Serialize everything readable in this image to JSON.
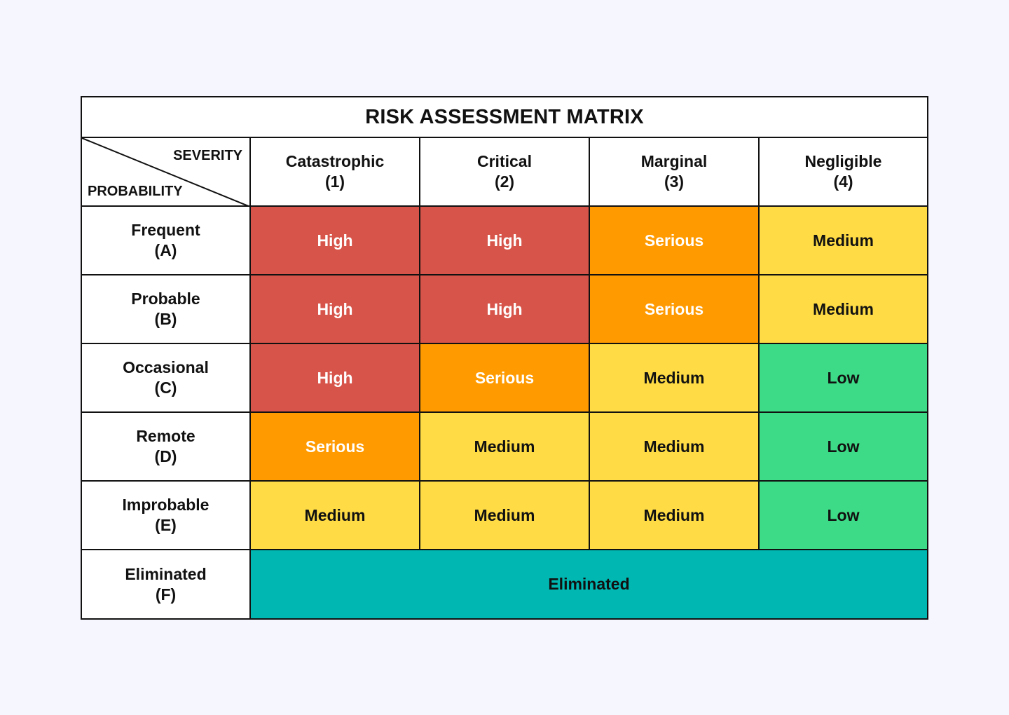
{
  "title": "RISK ASSESSMENT MATRIX",
  "corner": {
    "severity_label": "SEVERITY",
    "probability_label": "PROBABILITY"
  },
  "colors": {
    "High": {
      "bg": "#d65449",
      "fg": "#ffffff"
    },
    "Serious": {
      "bg": "#ff9a00",
      "fg": "#ffffff"
    },
    "Medium": {
      "bg": "#ffdc45",
      "fg": "#111111"
    },
    "Low": {
      "bg": "#3ddb87",
      "fg": "#111111"
    },
    "Eliminated": {
      "bg": "#00b7b1",
      "fg": "#111111"
    }
  },
  "severity": [
    {
      "name": "Catastrophic",
      "code": "(1)"
    },
    {
      "name": "Critical",
      "code": "(2)"
    },
    {
      "name": "Marginal",
      "code": "(3)"
    },
    {
      "name": "Negligible",
      "code": "(4)"
    }
  ],
  "rows": [
    {
      "name": "Frequent",
      "code": "(A)",
      "cells": [
        "High",
        "High",
        "Serious",
        "Medium"
      ]
    },
    {
      "name": "Probable",
      "code": "(B)",
      "cells": [
        "High",
        "High",
        "Serious",
        "Medium"
      ]
    },
    {
      "name": "Occasional",
      "code": "(C)",
      "cells": [
        "High",
        "Serious",
        "Medium",
        "Low"
      ]
    },
    {
      "name": "Remote",
      "code": "(D)",
      "cells": [
        "Serious",
        "Medium",
        "Medium",
        "Low"
      ]
    },
    {
      "name": "Improbable",
      "code": "(E)",
      "cells": [
        "Medium",
        "Medium",
        "Medium",
        "Low"
      ]
    }
  ],
  "eliminated_row": {
    "name": "Eliminated",
    "code": "(F)",
    "value": "Eliminated"
  }
}
